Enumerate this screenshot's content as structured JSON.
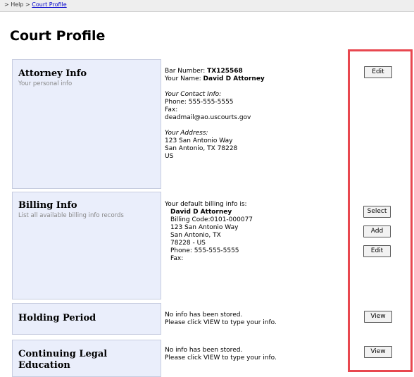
{
  "breadcrumb": {
    "prefix": "> Help >",
    "link": "Court Profile"
  },
  "page_title": "Court Profile",
  "sections": {
    "attorney": {
      "title": "Attorney Info",
      "subtitle": "Your personal info",
      "bar_label": "Bar Number:",
      "bar_number": "TX125568",
      "name_label": "Your Name:",
      "name": "David D Attorney",
      "contact_heading": "Your Contact Info:",
      "phone": "Phone: 555-555-5555",
      "fax": "Fax:",
      "email": "deadmail@ao.uscourts.gov",
      "address_heading": "Your Address:",
      "address_line1": "123 San Antonio Way",
      "address_line2": "San Antonio, TX 78228",
      "country": "US",
      "edit_label": "Edit"
    },
    "billing": {
      "title": "Billing Info",
      "subtitle": "List all available billing info records",
      "intro": "Your default billing info is:",
      "name": "David D Attorney",
      "code": "Billing Code:0101-000077",
      "street": "123 San Antonio Way",
      "city": "San Antonio, TX",
      "zip": "78228 - US",
      "phone": "Phone: 555-555-5555",
      "fax": "Fax:",
      "select_label": "Select",
      "add_label": "Add",
      "edit_label": "Edit"
    },
    "holding": {
      "title": "Holding Period",
      "line1": "No info has been stored.",
      "line2": "Please click VIEW to type your info.",
      "view_label": "View"
    },
    "cle": {
      "title_line1": "Continuing Legal",
      "title_line2": "Education",
      "line1": "No info has been stored.",
      "line2": "Please click VIEW to type your info.",
      "view_label": "View"
    }
  },
  "colors": {
    "section_bg": "#eaeefb",
    "highlight": "#e8474f",
    "link": "#0000cc"
  }
}
